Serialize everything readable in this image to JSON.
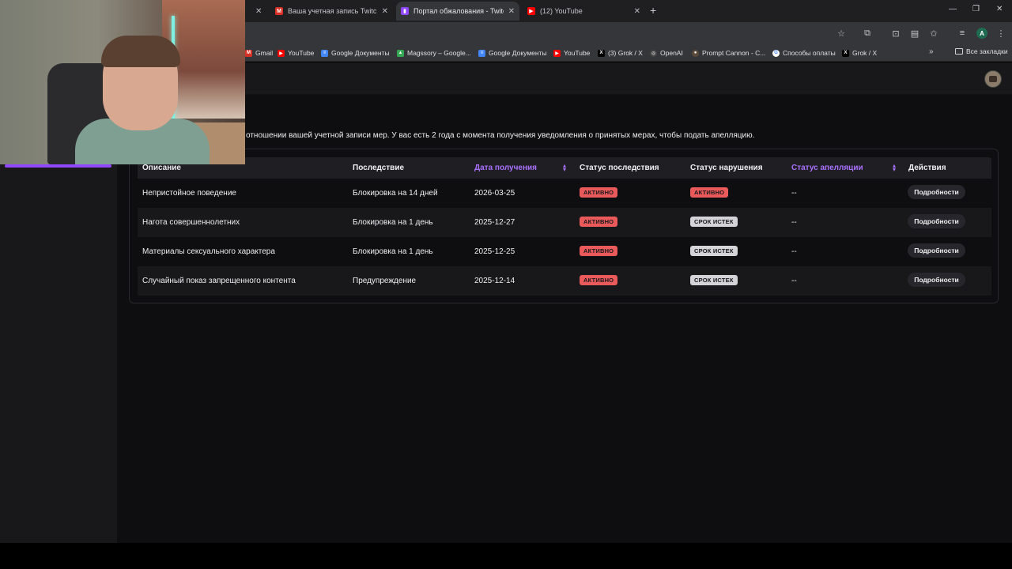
{
  "browser": {
    "tabs": [
      {
        "title": "Ваша учетная запись Twitch А",
        "favicon": "gmail-icon",
        "active": false
      },
      {
        "title": "Портал обжалования - Twitch",
        "favicon": "twitch-icon",
        "active": true
      },
      {
        "title": "(12) YouTube",
        "favicon": "youtube-icon",
        "active": false
      }
    ],
    "profile_initial": "A",
    "bookmarks": [
      {
        "label": "Gmail",
        "icon": "gmail-icon"
      },
      {
        "label": "YouTube",
        "icon": "youtube-icon"
      },
      {
        "label": "Google Документы",
        "icon": "docs-icon"
      },
      {
        "label": "Magssory – Google...",
        "icon": "drive-icon"
      },
      {
        "label": "Google Документы",
        "icon": "docs-icon"
      },
      {
        "label": "YouTube",
        "icon": "youtube-icon"
      },
      {
        "label": "(3) Grok / X",
        "icon": "x-icon"
      },
      {
        "label": "OpenAI",
        "icon": "openai-icon"
      },
      {
        "label": "Prompt Cannon - C...",
        "icon": "prompt-icon"
      },
      {
        "label": "Способы оплаты",
        "icon": "google-icon"
      },
      {
        "label": "Grok / X",
        "icon": "x-icon"
      }
    ],
    "all_bookmarks_label": "Все закладки"
  },
  "page": {
    "intro_text": "отношении вашей учетной записи мер. У вас есть 2 года с момента получения уведомления о принятых мерах, чтобы подать апелляцию.",
    "table": {
      "headers": {
        "description": "Описание",
        "consequence": "Последствие",
        "date_received": "Дата получения",
        "consequence_status": "Статус последствия",
        "violation_status": "Статус нарушения",
        "appeal_status": "Статус апелляции",
        "actions": "Действия"
      },
      "rows": [
        {
          "description": "Непристойное поведение",
          "consequence": "Блокировка на 14 дней",
          "date": "2026-03-25",
          "consequence_status": "АКТИВНО",
          "violation_status": "АКТИВНО",
          "appeal_status": "--",
          "action": "Подробности"
        },
        {
          "description": "Нагота совершеннолетних",
          "consequence": "Блокировка на 1 день",
          "date": "2025-12-27",
          "consequence_status": "АКТИВНО",
          "violation_status": "СРОК ИСТЕК",
          "appeal_status": "--",
          "action": "Подробности"
        },
        {
          "description": "Материалы сексуального характера",
          "consequence": "Блокировка на 1 день",
          "date": "2025-12-25",
          "consequence_status": "АКТИВНО",
          "violation_status": "СРОК ИСТЕК",
          "appeal_status": "--",
          "action": "Подробности"
        },
        {
          "description": "Случайный показ запрещенного контента",
          "consequence": "Предупреждение",
          "date": "2025-12-14",
          "consequence_status": "АКТИВНО",
          "violation_status": "СРОК ИСТЕК",
          "appeal_status": "--",
          "action": "Подробности"
        }
      ]
    }
  },
  "colors": {
    "accent": "#a970ff",
    "active_badge": "#eb5a5a",
    "expired_badge": "#d3d3d8",
    "background": "#0e0e10"
  }
}
